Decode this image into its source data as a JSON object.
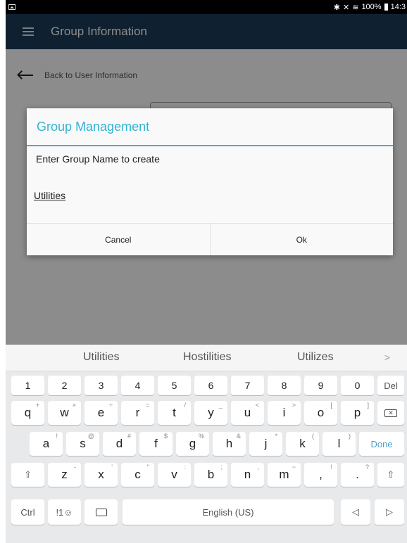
{
  "status_bar": {
    "battery": "100%",
    "time": "14:3"
  },
  "appbar": {
    "title": "Group Information"
  },
  "back_link": {
    "label": "Back to User Information"
  },
  "dialog": {
    "title": "Group Management",
    "message": "Enter Group Name to create",
    "input_value": "Utilities",
    "cancel_label": "Cancel",
    "ok_label": "Ok",
    "accent_color": "#34b3d3"
  },
  "keyboard": {
    "suggestions": [
      "Utilities",
      "Hostilities",
      "Utilizes"
    ],
    "row_numbers": [
      "1",
      "2",
      "3",
      "4",
      "5",
      "6",
      "7",
      "8",
      "9",
      "0"
    ],
    "del_label": "Del",
    "row_q": [
      {
        "key": "q",
        "hint": "+"
      },
      {
        "key": "w",
        "hint": "×"
      },
      {
        "key": "e",
        "hint": "÷"
      },
      {
        "key": "r",
        "hint": "="
      },
      {
        "key": "t",
        "hint": "/"
      },
      {
        "key": "y",
        "hint": "_"
      },
      {
        "key": "u",
        "hint": "<"
      },
      {
        "key": "i",
        "hint": ">"
      },
      {
        "key": "o",
        "hint": "["
      },
      {
        "key": "p",
        "hint": "]"
      }
    ],
    "row_a": [
      {
        "key": "a",
        "hint": "!"
      },
      {
        "key": "s",
        "hint": "@"
      },
      {
        "key": "d",
        "hint": "#"
      },
      {
        "key": "f",
        "hint": "$"
      },
      {
        "key": "g",
        "hint": "%"
      },
      {
        "key": "h",
        "hint": "&"
      },
      {
        "key": "j",
        "hint": "*"
      },
      {
        "key": "k",
        "hint": "("
      },
      {
        "key": "l",
        "hint": ")"
      }
    ],
    "done_label": "Done",
    "row_z": [
      {
        "key": "z",
        "hint": "-"
      },
      {
        "key": "x",
        "hint": "'"
      },
      {
        "key": "c",
        "hint": "\""
      },
      {
        "key": "v",
        "hint": ":"
      },
      {
        "key": "b",
        "hint": ";"
      },
      {
        "key": "n",
        "hint": ","
      },
      {
        "key": "m",
        "hint": "~"
      },
      {
        "key": ",",
        "hint": "!"
      },
      {
        "key": ".",
        "hint": "?"
      }
    ],
    "ctrl_label": "Ctrl",
    "symbols_label": "!1☺",
    "space_label": "English (US)",
    "accent_color": "#4f9fc8"
  }
}
